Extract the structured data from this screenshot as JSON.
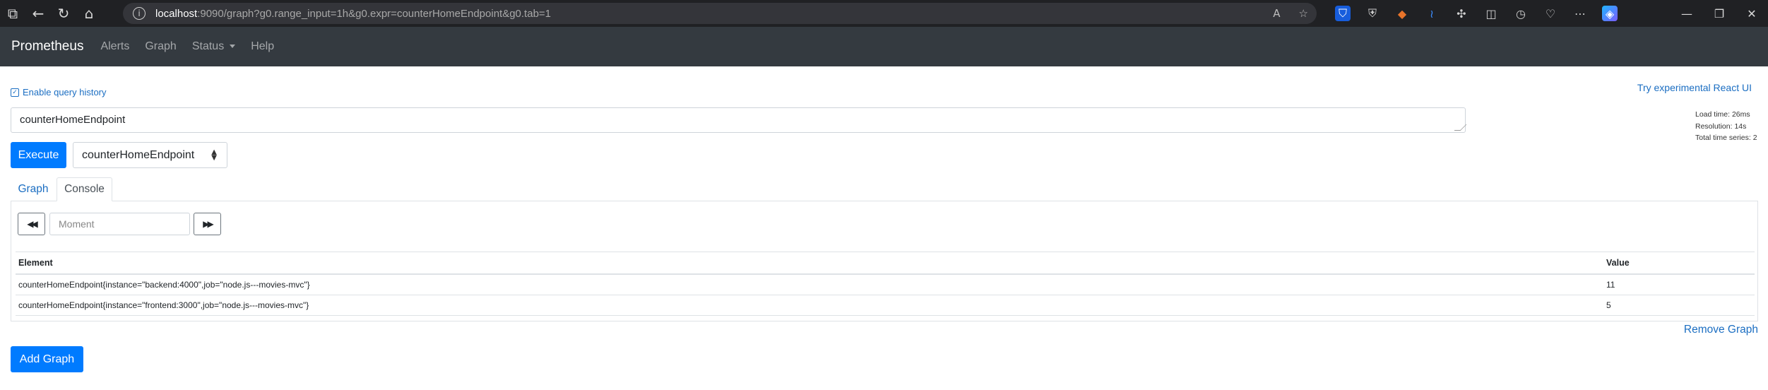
{
  "browser": {
    "url_host": "localhost",
    "url_rest": ":9090/graph?g0.range_input=1h&g0.expr=counterHomeEndpoint&g0.tab=1",
    "icons": [
      "tabs-icon",
      "back-icon",
      "refresh-icon",
      "home-icon"
    ],
    "address_icons": [
      "read-aloud-icon",
      "favorite-icon"
    ],
    "extension_icons": [
      "bitwarden-icon",
      "shield-icon",
      "fox-icon",
      "wave-icon",
      "extensions-icon",
      "split-screen-icon",
      "history-icon",
      "health-icon",
      "more-icon",
      "copilot-icon"
    ],
    "window_controls": [
      "minimize-icon",
      "restore-icon",
      "close-icon"
    ]
  },
  "navbar": {
    "brand": "Prometheus",
    "links": [
      "Alerts",
      "Graph",
      "Status",
      "Help"
    ]
  },
  "page": {
    "enable_history": "Enable query history",
    "react_link": "Try experimental React UI",
    "load_time": "Load time: 26ms",
    "resolution": "Resolution: 14s",
    "total_series": "Total time series: 2",
    "expression": "counterHomeEndpoint",
    "execute_label": "Execute",
    "metric_selected": "counterHomeEndpoint",
    "tabs": [
      "Graph",
      "Console"
    ],
    "moment_placeholder": "Moment",
    "table": {
      "headers": [
        "Element",
        "Value"
      ],
      "rows": [
        {
          "element": "counterHomeEndpoint{instance=\"backend:4000\",job=\"node.js---movies-mvc\"}",
          "value": "11"
        },
        {
          "element": "counterHomeEndpoint{instance=\"frontend:3000\",job=\"node.js---movies-mvc\"}",
          "value": "5"
        }
      ]
    },
    "remove_graph": "Remove Graph",
    "add_graph": "Add Graph"
  },
  "colors": {
    "accent": "#007bff",
    "link": "#1b6ec2",
    "navbar": "#343a40",
    "chrome": "#202124"
  }
}
